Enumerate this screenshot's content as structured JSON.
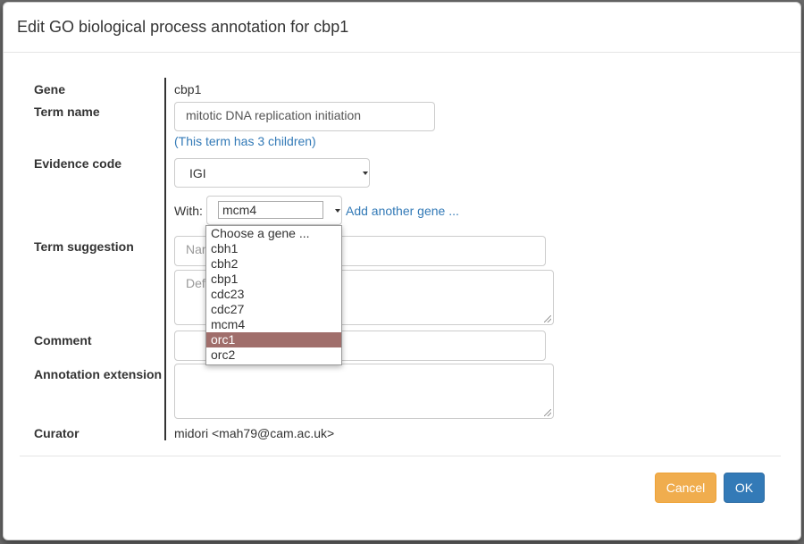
{
  "dialog": {
    "title": "Edit GO biological process annotation for cbp1"
  },
  "form": {
    "gene_label": "Gene",
    "gene_value": "cbp1",
    "term_name_label": "Term name",
    "term_name_value": "mitotic DNA replication initiation",
    "term_children_link": "(This term has 3 children)",
    "evidence_code_label": "Evidence code",
    "evidence_code_value": "IGI",
    "with_label": "With:",
    "with_value": "mcm4",
    "add_another_gene_link": "Add another gene ...",
    "term_suggestion_label": "Term suggestion",
    "term_suggestion_name_placeholder": "Name",
    "term_suggestion_definition_placeholder": "Definition",
    "comment_label": "Comment",
    "annotation_extension_label": "Annotation extension",
    "curator_label": "Curator",
    "curator_value": "midori <mah79@cam.ac.uk>"
  },
  "with_dropdown": {
    "options": [
      "Choose a gene ...",
      "cbh1",
      "cbh2",
      "cbp1",
      "cdc23",
      "cdc27",
      "mcm4",
      "orc1",
      "orc2"
    ],
    "highlighted": "orc1"
  },
  "footer": {
    "cancel_label": "Cancel",
    "ok_label": "OK"
  },
  "colors": {
    "cancel": "#f0ad4e",
    "ok": "#337ab7",
    "link": "#337ab7",
    "highlight": "#a06e6b"
  }
}
